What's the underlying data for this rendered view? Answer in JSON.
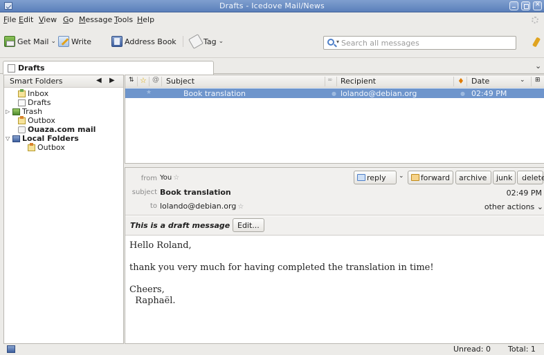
{
  "window": {
    "title": "Drafts - Icedove Mail/News",
    "buttons": [
      "minimize-icon",
      "maximize-icon",
      "close-icon"
    ]
  },
  "menubar": [
    "File",
    "Edit",
    "View",
    "Go",
    "Message",
    "Tools",
    "Help"
  ],
  "toolbar": {
    "get_mail": "Get Mail",
    "write": "Write",
    "address_book": "Address Book",
    "tag": "Tag",
    "search_placeholder": "Search all messages"
  },
  "tab": {
    "label": "Drafts"
  },
  "folder_pane": {
    "header": "Smart Folders",
    "folders": [
      {
        "label": "Inbox",
        "icon": "inbox-icon"
      },
      {
        "label": "Drafts",
        "icon": "drafts-icon"
      },
      {
        "label": "Trash",
        "icon": "trash-icon"
      },
      {
        "label": "Outbox",
        "icon": "outbox-icon"
      },
      {
        "label": "Ouaza.com mail",
        "icon": "mail-account-icon"
      },
      {
        "label": "Local Folders",
        "icon": "local-folders-icon"
      },
      {
        "label": "Outbox",
        "icon": "outbox-icon"
      }
    ]
  },
  "thread_pane": {
    "columns": {
      "subject": "Subject",
      "recipient": "Recipient",
      "date": "Date"
    },
    "rows": [
      {
        "subject": "Book translation",
        "recipient": "lolando@debian.org",
        "date": "02:49 PM"
      }
    ]
  },
  "message": {
    "labels": {
      "from": "from",
      "subject": "subject",
      "to": "to"
    },
    "from": "You",
    "subject": "Book translation",
    "to": "lolando@debian.org",
    "date": "02:49 PM",
    "buttons": {
      "reply": "reply",
      "forward": "forward",
      "archive": "archive",
      "junk": "junk",
      "delete": "delete"
    },
    "other_actions": "other actions",
    "draft_notice": "This is a draft message",
    "edit_button": "Edit...",
    "body": [
      "Hello Roland,",
      "thank you very much for having completed the translation in time!",
      "Cheers,",
      "  Raphaël."
    ]
  },
  "status": {
    "unread": "Unread: 0",
    "total": "Total: 1"
  }
}
